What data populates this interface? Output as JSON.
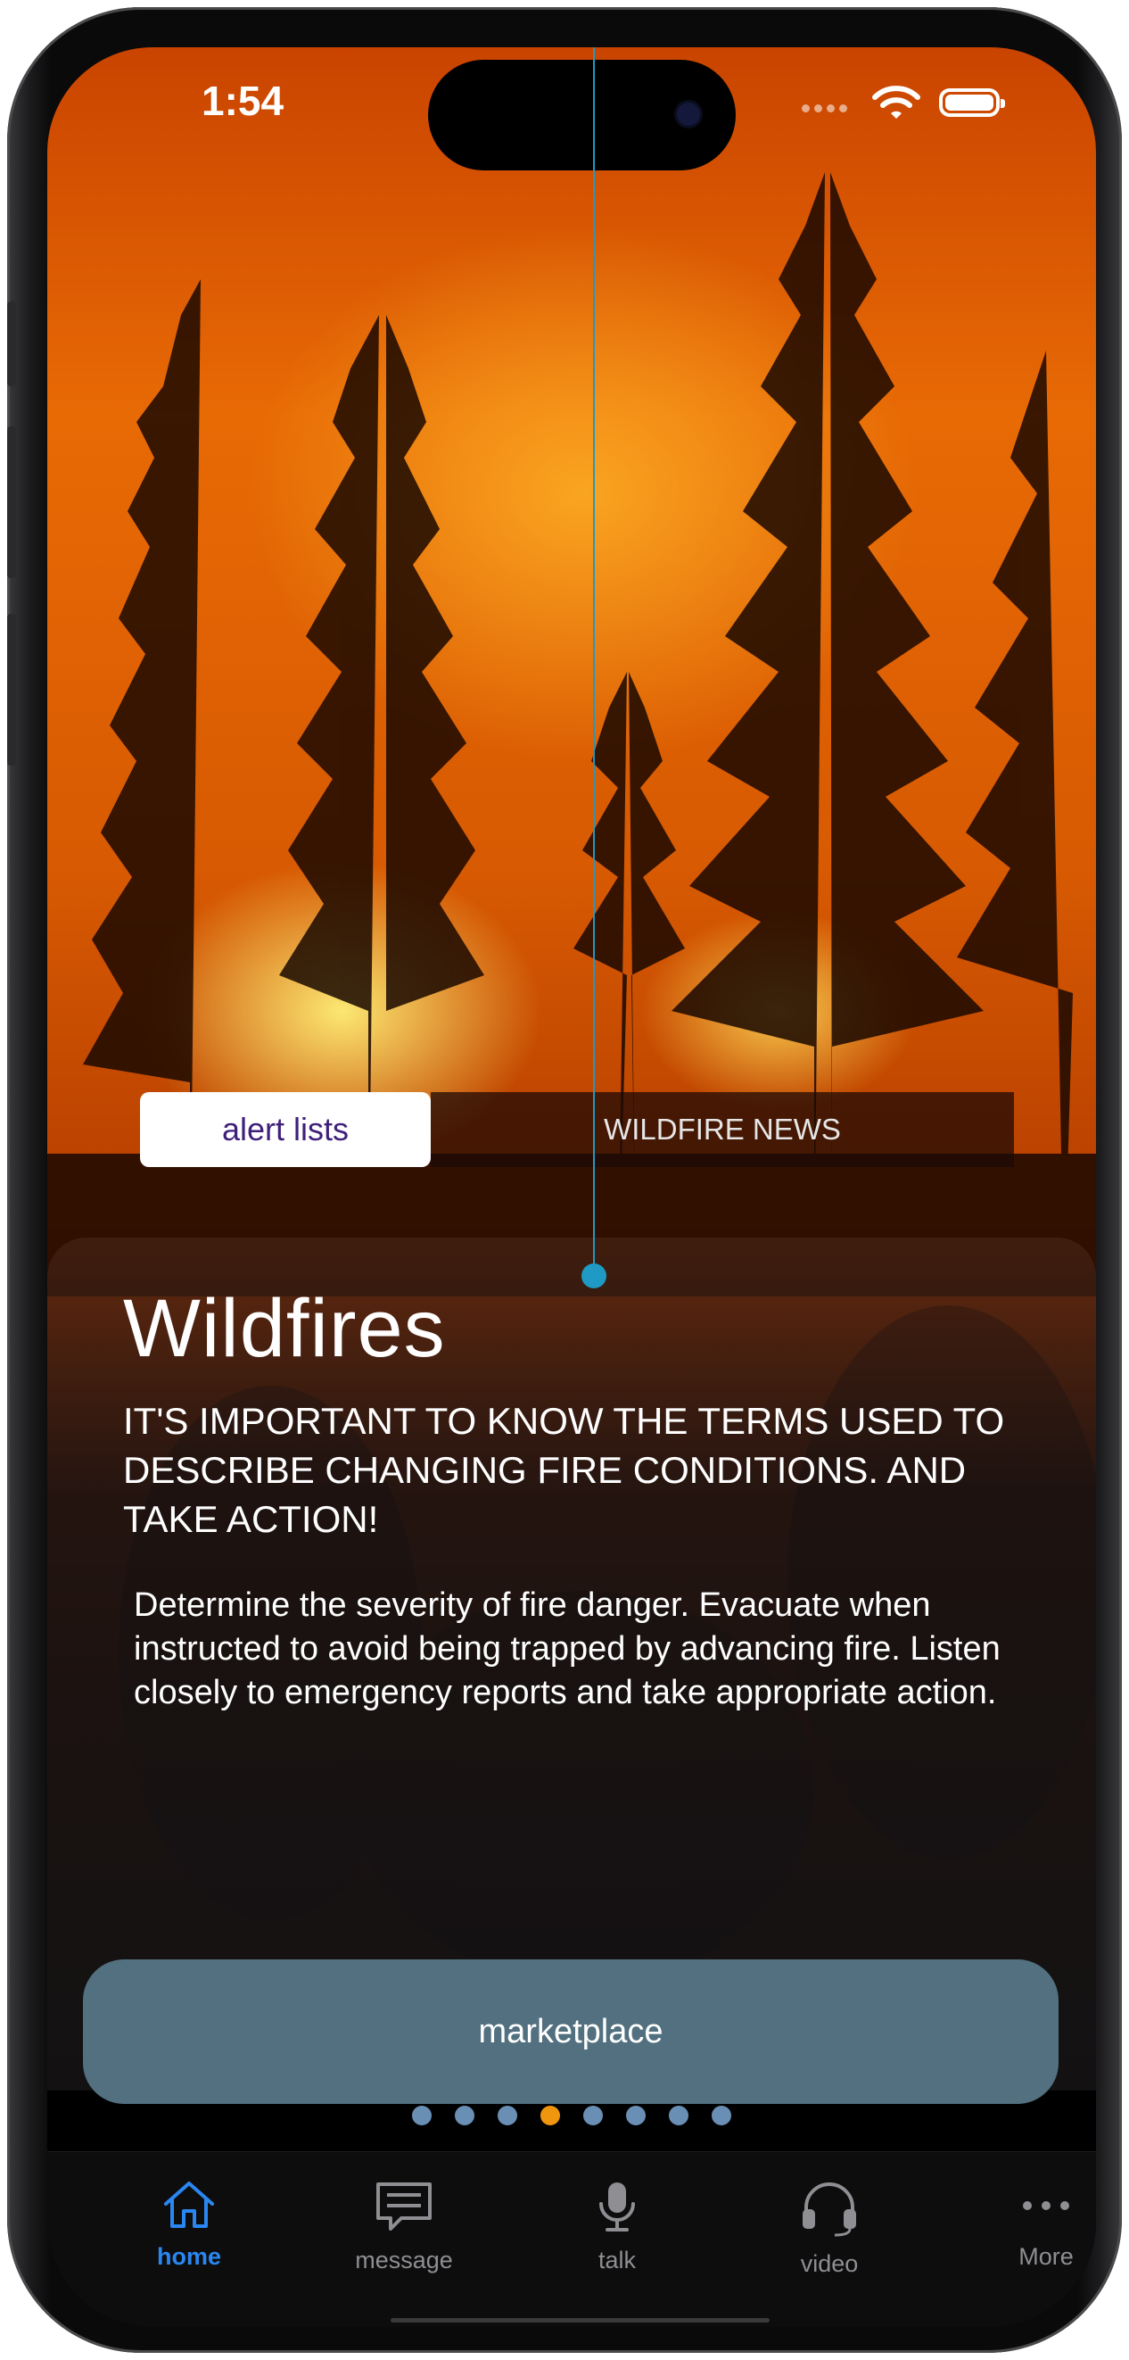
{
  "status_bar": {
    "time": "1:54"
  },
  "segmented_control": {
    "active": "alert lists",
    "inactive": "WILDFIRE NEWS"
  },
  "card": {
    "title": "Wildfires",
    "subtitle": "IT'S IMPORTANT TO KNOW THE TERMS USED TO DESCRIBE CHANGING FIRE CONDITIONS. AND TAKE ACTION!",
    "body": "Determine the severity of fire danger. Evacuate when instructed to avoid being trapped by advancing fire. Listen closely to emergency reports and take appropriate action.",
    "button": "marketplace"
  },
  "pager": {
    "count": 8,
    "active_index": 3
  },
  "tab_bar": {
    "items": [
      {
        "label": "home",
        "icon": "house-icon",
        "active": true
      },
      {
        "label": "message",
        "icon": "message-icon",
        "active": false
      },
      {
        "label": "talk",
        "icon": "microphone-icon",
        "active": false
      },
      {
        "label": "video",
        "icon": "headset-icon",
        "active": false
      },
      {
        "label": "More",
        "icon": "ellipsis-icon",
        "active": false
      }
    ]
  },
  "colors": {
    "accent": "#2a86f0",
    "pager_active": "#f0950e",
    "pager_inactive": "#6a8fb5",
    "button_bg": "#52707f",
    "guide": "#1e9ac4"
  }
}
